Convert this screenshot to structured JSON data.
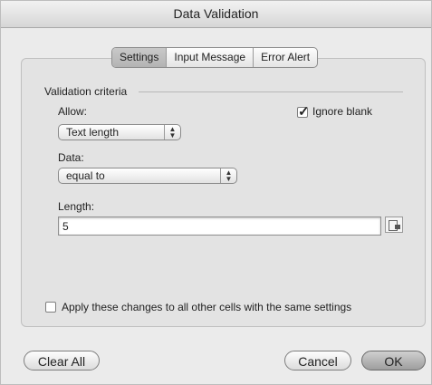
{
  "window": {
    "title": "Data Validation"
  },
  "tabs": [
    {
      "label": "Settings",
      "active": true
    },
    {
      "label": "Input Message",
      "active": false
    },
    {
      "label": "Error Alert",
      "active": false
    }
  ],
  "validation": {
    "group_label": "Validation criteria",
    "allow_label": "Allow:",
    "allow_value": "Text length",
    "ignore_blank_label": "Ignore blank",
    "ignore_blank_checked": true,
    "data_label": "Data:",
    "data_value": "equal to",
    "length_label": "Length:",
    "length_value": "5",
    "apply_label": "Apply these changes to all other cells with the same settings",
    "apply_checked": false
  },
  "buttons": {
    "clear_all": "Clear All",
    "cancel": "Cancel",
    "ok": "OK"
  },
  "icons": {
    "popup_arrows": "↕",
    "ref": "range-selector-icon"
  }
}
